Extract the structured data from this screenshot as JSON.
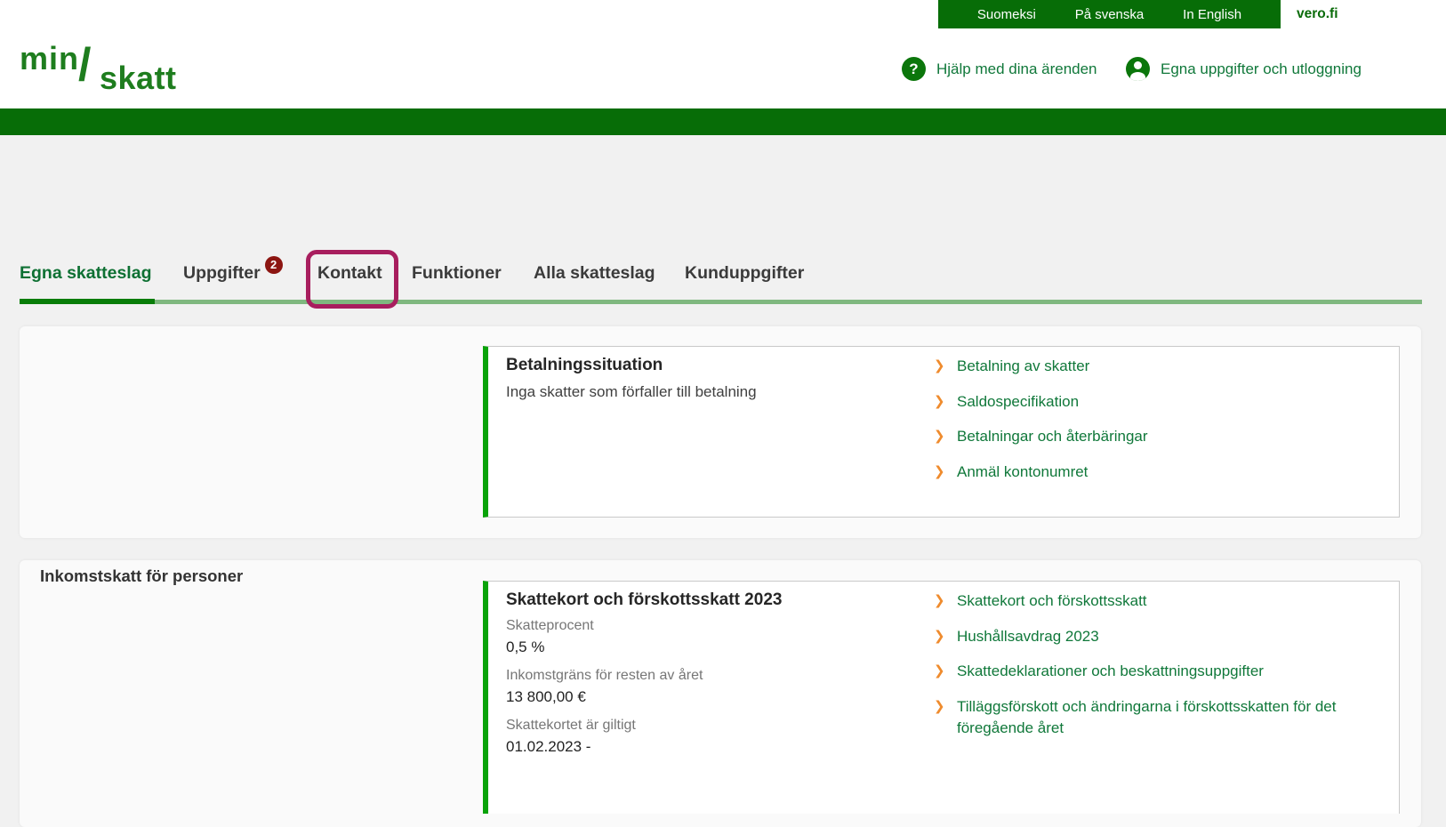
{
  "top_bar": {
    "languages": [
      {
        "label": "Suomeksi"
      },
      {
        "label": "På svenska"
      },
      {
        "label": "In English"
      }
    ],
    "brand_link": "vero.fi"
  },
  "header": {
    "logo": {
      "part1": "min",
      "slash": "/",
      "part2": "skatt"
    },
    "help_label": "Hjälp med dina ärenden",
    "profile_label": "Egna uppgifter och utloggning"
  },
  "icons": {
    "help_glyph": "?",
    "chevron_glyph": "❯"
  },
  "tabs": [
    {
      "label": "Egna skatteslag",
      "active": true
    },
    {
      "label": "Uppgifter",
      "badge": "2"
    },
    {
      "label": "Kontakt",
      "annotated": true
    },
    {
      "label": "Funktioner"
    },
    {
      "label": "Alla skatteslag"
    },
    {
      "label": "Kunduppgifter"
    }
  ],
  "sections": [
    {
      "card": {
        "title": "Betalningssituation",
        "subtitle": "Inga skatter som förfaller till betalning",
        "links": [
          "Betalning av skatter",
          "Saldospecifikation",
          "Betalningar och återbäringar",
          "Anmäl kontonumret"
        ]
      }
    },
    {
      "heading": "Inkomstskatt för personer",
      "card": {
        "title": "Skattekort och förskottsskatt 2023",
        "fields": [
          {
            "label": "Skatteprocent",
            "value": "0,5 %"
          },
          {
            "label": "Inkomstgräns för resten av året",
            "value": "13 800,00 €"
          },
          {
            "label": "Skattekortet är giltigt",
            "value": "01.02.2023 -"
          }
        ],
        "links": [
          "Skattekort och förskottsskatt",
          "Hushållsavdrag 2023",
          "Skattedeklarationer och beskattningsuppgifter",
          "Tilläggsförskott och ändringarna i förskottsskatten för det föregående året"
        ]
      }
    }
  ],
  "colors": {
    "brand_green": "#076d07",
    "logo_green": "#1e7d1e",
    "link_green": "#10783a",
    "active_underline_green": "#087d08",
    "sage_underline": "#7fb87f",
    "card_border_green": "#09a309",
    "chevron_orange": "#ef8b2d",
    "badge_red": "#8c1511",
    "annotation_magenta": "#a81e5e"
  }
}
